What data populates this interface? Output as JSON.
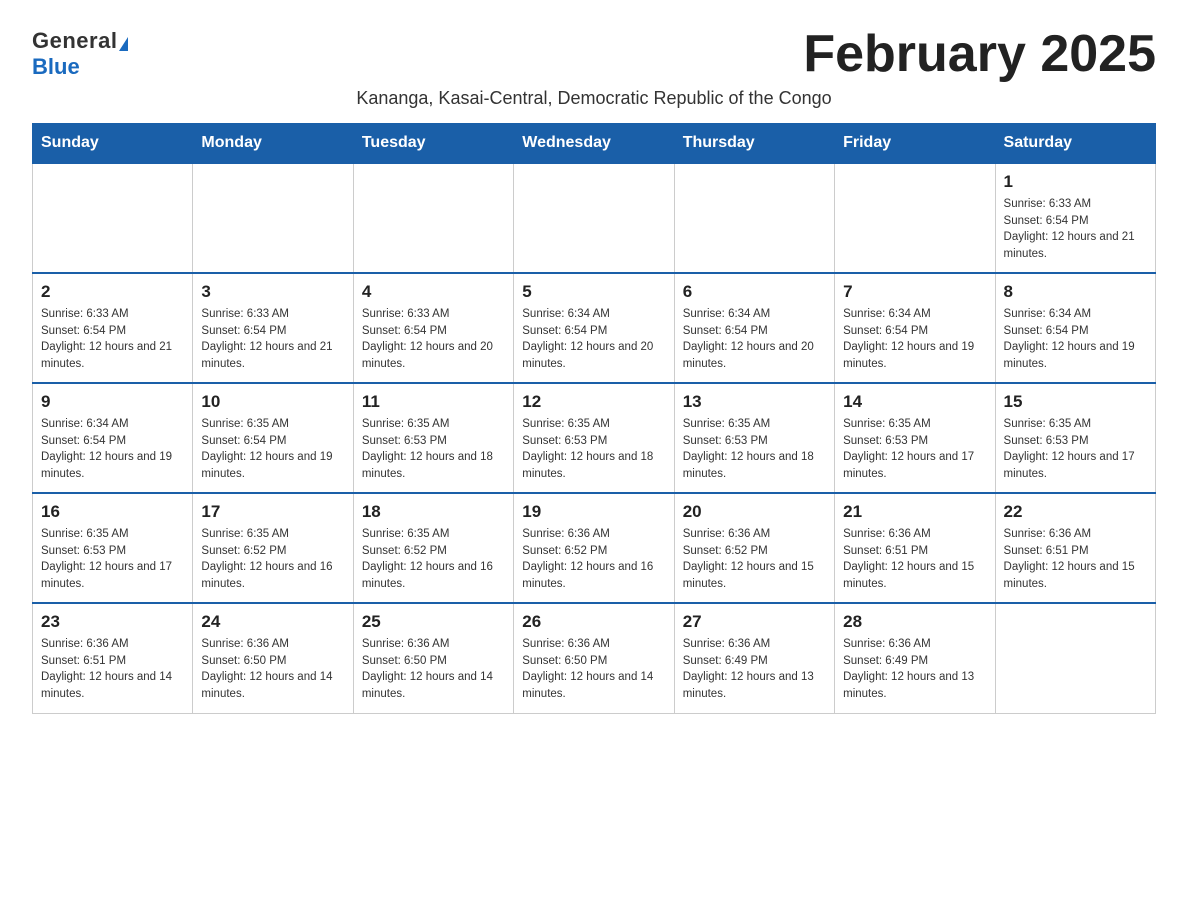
{
  "logo": {
    "general": "General",
    "blue": "Blue"
  },
  "title": "February 2025",
  "subtitle": "Kananga, Kasai-Central, Democratic Republic of the Congo",
  "days_of_week": [
    "Sunday",
    "Monday",
    "Tuesday",
    "Wednesday",
    "Thursday",
    "Friday",
    "Saturday"
  ],
  "weeks": [
    [
      {
        "day": "",
        "info": ""
      },
      {
        "day": "",
        "info": ""
      },
      {
        "day": "",
        "info": ""
      },
      {
        "day": "",
        "info": ""
      },
      {
        "day": "",
        "info": ""
      },
      {
        "day": "",
        "info": ""
      },
      {
        "day": "1",
        "info": "Sunrise: 6:33 AM\nSunset: 6:54 PM\nDaylight: 12 hours and 21 minutes."
      }
    ],
    [
      {
        "day": "2",
        "info": "Sunrise: 6:33 AM\nSunset: 6:54 PM\nDaylight: 12 hours and 21 minutes."
      },
      {
        "day": "3",
        "info": "Sunrise: 6:33 AM\nSunset: 6:54 PM\nDaylight: 12 hours and 21 minutes."
      },
      {
        "day": "4",
        "info": "Sunrise: 6:33 AM\nSunset: 6:54 PM\nDaylight: 12 hours and 20 minutes."
      },
      {
        "day": "5",
        "info": "Sunrise: 6:34 AM\nSunset: 6:54 PM\nDaylight: 12 hours and 20 minutes."
      },
      {
        "day": "6",
        "info": "Sunrise: 6:34 AM\nSunset: 6:54 PM\nDaylight: 12 hours and 20 minutes."
      },
      {
        "day": "7",
        "info": "Sunrise: 6:34 AM\nSunset: 6:54 PM\nDaylight: 12 hours and 19 minutes."
      },
      {
        "day": "8",
        "info": "Sunrise: 6:34 AM\nSunset: 6:54 PM\nDaylight: 12 hours and 19 minutes."
      }
    ],
    [
      {
        "day": "9",
        "info": "Sunrise: 6:34 AM\nSunset: 6:54 PM\nDaylight: 12 hours and 19 minutes."
      },
      {
        "day": "10",
        "info": "Sunrise: 6:35 AM\nSunset: 6:54 PM\nDaylight: 12 hours and 19 minutes."
      },
      {
        "day": "11",
        "info": "Sunrise: 6:35 AM\nSunset: 6:53 PM\nDaylight: 12 hours and 18 minutes."
      },
      {
        "day": "12",
        "info": "Sunrise: 6:35 AM\nSunset: 6:53 PM\nDaylight: 12 hours and 18 minutes."
      },
      {
        "day": "13",
        "info": "Sunrise: 6:35 AM\nSunset: 6:53 PM\nDaylight: 12 hours and 18 minutes."
      },
      {
        "day": "14",
        "info": "Sunrise: 6:35 AM\nSunset: 6:53 PM\nDaylight: 12 hours and 17 minutes."
      },
      {
        "day": "15",
        "info": "Sunrise: 6:35 AM\nSunset: 6:53 PM\nDaylight: 12 hours and 17 minutes."
      }
    ],
    [
      {
        "day": "16",
        "info": "Sunrise: 6:35 AM\nSunset: 6:53 PM\nDaylight: 12 hours and 17 minutes."
      },
      {
        "day": "17",
        "info": "Sunrise: 6:35 AM\nSunset: 6:52 PM\nDaylight: 12 hours and 16 minutes."
      },
      {
        "day": "18",
        "info": "Sunrise: 6:35 AM\nSunset: 6:52 PM\nDaylight: 12 hours and 16 minutes."
      },
      {
        "day": "19",
        "info": "Sunrise: 6:36 AM\nSunset: 6:52 PM\nDaylight: 12 hours and 16 minutes."
      },
      {
        "day": "20",
        "info": "Sunrise: 6:36 AM\nSunset: 6:52 PM\nDaylight: 12 hours and 15 minutes."
      },
      {
        "day": "21",
        "info": "Sunrise: 6:36 AM\nSunset: 6:51 PM\nDaylight: 12 hours and 15 minutes."
      },
      {
        "day": "22",
        "info": "Sunrise: 6:36 AM\nSunset: 6:51 PM\nDaylight: 12 hours and 15 minutes."
      }
    ],
    [
      {
        "day": "23",
        "info": "Sunrise: 6:36 AM\nSunset: 6:51 PM\nDaylight: 12 hours and 14 minutes."
      },
      {
        "day": "24",
        "info": "Sunrise: 6:36 AM\nSunset: 6:50 PM\nDaylight: 12 hours and 14 minutes."
      },
      {
        "day": "25",
        "info": "Sunrise: 6:36 AM\nSunset: 6:50 PM\nDaylight: 12 hours and 14 minutes."
      },
      {
        "day": "26",
        "info": "Sunrise: 6:36 AM\nSunset: 6:50 PM\nDaylight: 12 hours and 14 minutes."
      },
      {
        "day": "27",
        "info": "Sunrise: 6:36 AM\nSunset: 6:49 PM\nDaylight: 12 hours and 13 minutes."
      },
      {
        "day": "28",
        "info": "Sunrise: 6:36 AM\nSunset: 6:49 PM\nDaylight: 12 hours and 13 minutes."
      },
      {
        "day": "",
        "info": ""
      }
    ]
  ]
}
